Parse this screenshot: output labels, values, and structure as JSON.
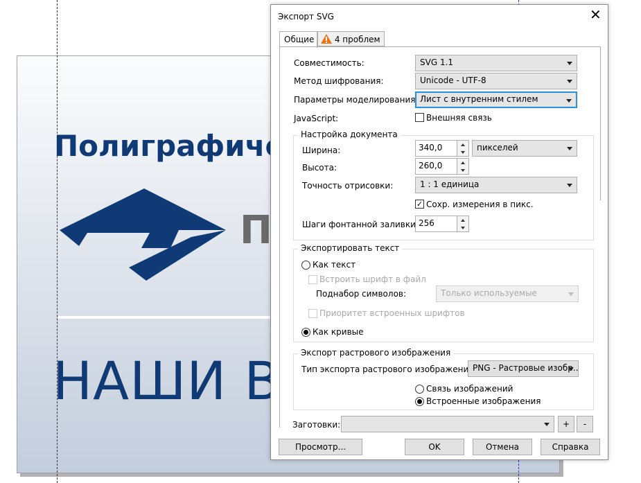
{
  "canvas": {
    "brand_text": "Полиграфиче",
    "logo_partial": "П",
    "headline": "НАШИ ВА"
  },
  "dialog": {
    "title": "Экспорт SVG",
    "tabs": [
      {
        "label": "Общие"
      },
      {
        "label": "4 проблем",
        "icon": "warning-icon"
      }
    ],
    "general": {
      "compat_label": "Совместимость:",
      "compat_value": "SVG 1.1",
      "encoding_label": "Метод шифрования:",
      "encoding_value": "Unicode - UTF-8",
      "styling_label": "Параметры моделирования:",
      "styling_value": "Лист с внутренним стилем",
      "js_label": "JavaScript:",
      "js_link_label": "Внешняя связь",
      "js_link_checked": false
    },
    "document": {
      "title": "Настройка документа",
      "width_label": "Ширина:",
      "width_value": "340,0",
      "units_value": "пикселей",
      "height_label": "Высота:",
      "height_value": "260,0",
      "precision_label": "Точность отрисовки:",
      "precision_value": "1 : 1 единица",
      "keep_px_label": "Сохр. измерения в пикс.",
      "keep_px_checked": true,
      "fountain_label": "Шаги фонтанной заливки:",
      "fountain_value": "256"
    },
    "text_export": {
      "title": "Экспортировать текст",
      "as_text_label": "Как текст",
      "embed_font_label": "Встроить шрифт в файл",
      "subset_label": "Поднабор символов:",
      "subset_value": "Только используемые",
      "priority_label": "Приоритет встроенных шрифтов",
      "as_curves_label": "Как кривые",
      "selected": "Как кривые"
    },
    "bitmap": {
      "title": "Экспорт растрового изображения",
      "type_label": "Тип экспорта растрового изображения:",
      "type_value": "PNG - Растровые изобр...",
      "link_label": "Связь изображений",
      "embed_label": "Встроенные изображения",
      "selected": "Встроенные изображения"
    },
    "presets": {
      "label": "Заготовки:",
      "value": "",
      "add": "+",
      "remove": "-"
    },
    "buttons": {
      "preview": "Просмотр...",
      "ok": "OK",
      "cancel": "Отмена",
      "help": "Справка"
    },
    "colors": {
      "accent": "#2a8fe0",
      "warning": "#f47216",
      "brand": "#0f3a75"
    }
  }
}
